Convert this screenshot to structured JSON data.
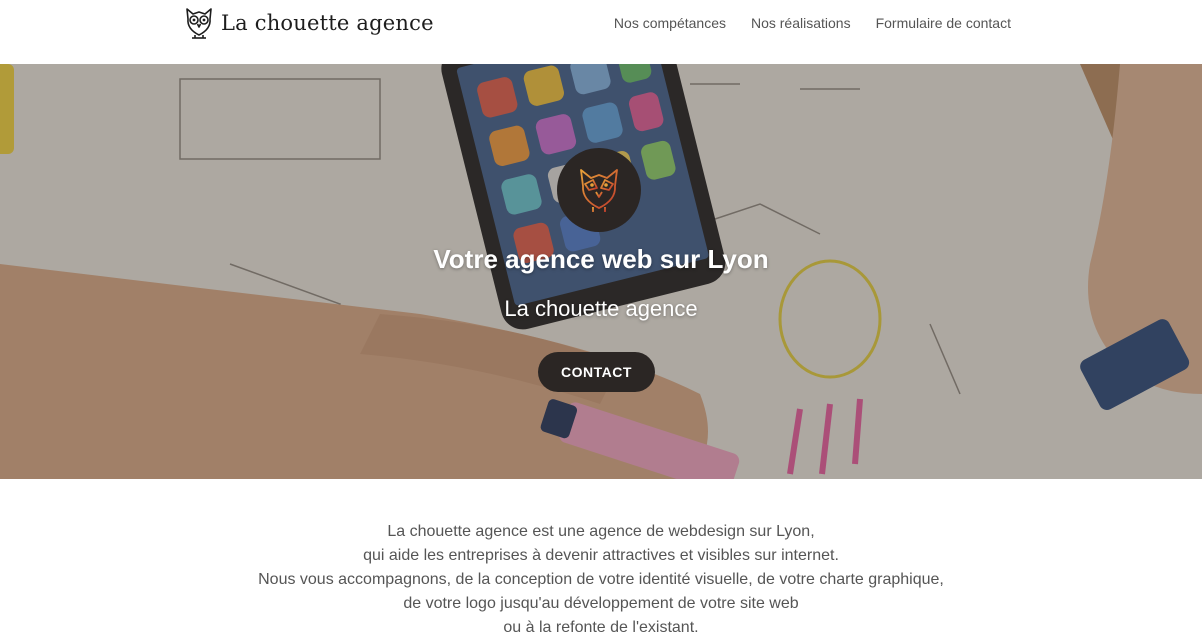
{
  "header": {
    "brand_name": "La chouette agence",
    "logo_icon": "owl-icon",
    "nav": [
      {
        "label": "Nos compétances"
      },
      {
        "label": "Nos réalisations"
      },
      {
        "label": "Formulaire de contact"
      }
    ]
  },
  "hero": {
    "badge_icon": "owl-icon",
    "title": "Votre agence web sur Lyon",
    "subtitle": "La chouette agence",
    "cta_label": "CONTACT",
    "colors": {
      "overlay": "#463e38",
      "button_bg": "#2b2624",
      "owl_gradient_start": "#e8a23a",
      "owl_gradient_end": "#c0392b"
    }
  },
  "intro": {
    "lines": [
      "La chouette agence est une agence de webdesign sur Lyon,",
      "qui aide les entreprises à devenir attractives et visibles sur internet.",
      "Nous vous accompagnons, de la conception de votre identité visuelle, de votre charte graphique,",
      "de votre logo jusqu'au développement de votre site web",
      "ou à la refonte de l'existant."
    ]
  }
}
